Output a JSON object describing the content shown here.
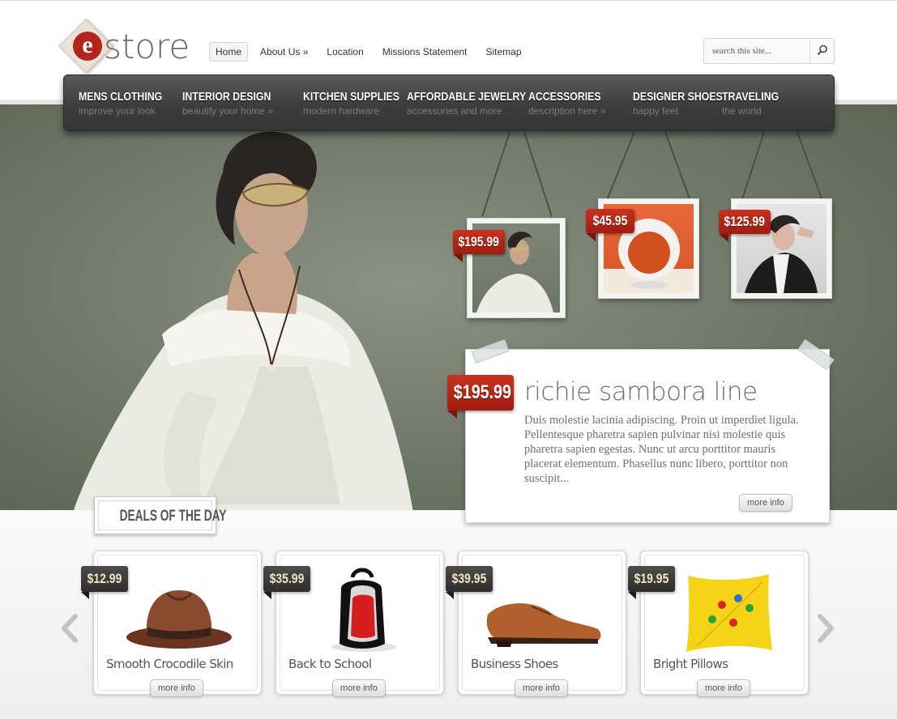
{
  "brand": {
    "logo_letter": "e",
    "logo_text": "store"
  },
  "topnav": [
    {
      "label": "Home"
    },
    {
      "label": "About Us »"
    },
    {
      "label": "Location"
    },
    {
      "label": "Missions Statement"
    },
    {
      "label": "Sitemap"
    }
  ],
  "search": {
    "placeholder": "search this site..."
  },
  "mainnav": [
    {
      "title": "MENS CLOTHING",
      "sub": "improve your look"
    },
    {
      "title": "INTERIOR DESIGN",
      "sub": "beautify your home »"
    },
    {
      "title": "KITCHEN SUPPLIES",
      "sub": "modern hardware"
    },
    {
      "title": "AFFORDABLE JEWELRY",
      "sub": "accessories and more"
    },
    {
      "title": "ACCESSORIES",
      "sub": "description here »"
    },
    {
      "title": "DESIGNER SHOES",
      "sub": "happy feet"
    },
    {
      "title": "TRAVELING",
      "sub": "the world"
    }
  ],
  "hero": {
    "thumbs": [
      {
        "price": "$195.99"
      },
      {
        "price": "$45.95"
      },
      {
        "price": "$125.99"
      }
    ],
    "feature": {
      "price": "$195.99",
      "title": "richie sambora line",
      "description": "Duis molestie lacinia adipiscing. Proin ut imperdiet ligula. Pellentesque pharetra sapien pulvinar nisi molestie quis pharetra sapien egestas. Nunc ut arcu porttitor mauris placerat elementum. Phasellus nunc libero, porttitor non suscipit...",
      "more_label": "more info"
    }
  },
  "deals": {
    "label": "DEALS OF THE DAY",
    "items": [
      {
        "price": "$12.99",
        "title": "Smooth Crocodile Skin",
        "more_label": "more info"
      },
      {
        "price": "$35.99",
        "title": "Back to School",
        "more_label": "more info"
      },
      {
        "price": "$39.95",
        "title": "Business Shoes",
        "more_label": "more info"
      },
      {
        "price": "$19.95",
        "title": "Bright Pillows",
        "more_label": "more info"
      }
    ]
  },
  "colors": {
    "accent_red": "#b3251b",
    "nav_dark": "#3d3d3d",
    "hero_green": "#6f7868"
  }
}
